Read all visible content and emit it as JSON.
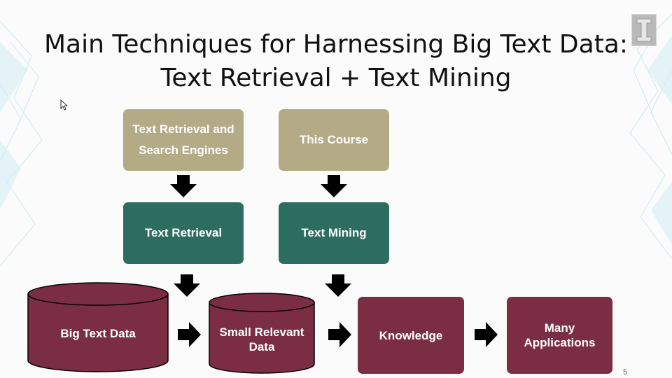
{
  "slide": {
    "title_line1": "Main Techniques for Harnessing Big Text Data:",
    "title_line2": "Text Retrieval + Text Mining",
    "page_number": "5"
  },
  "diagram": {
    "top_left": "Text Retrieval and Search Engines",
    "top_right": "This Course",
    "mid_left": "Text Retrieval",
    "mid_right": "Text Mining",
    "big_text_data": "Big Text Data",
    "small_relevant_data": "Small Relevant Data",
    "knowledge": "Knowledge",
    "many_applications": "Many Applications"
  },
  "colors": {
    "tan": "#b3aa86",
    "green": "#2d6d5f",
    "maroon": "#7a2d43",
    "arrow": "#000000"
  }
}
